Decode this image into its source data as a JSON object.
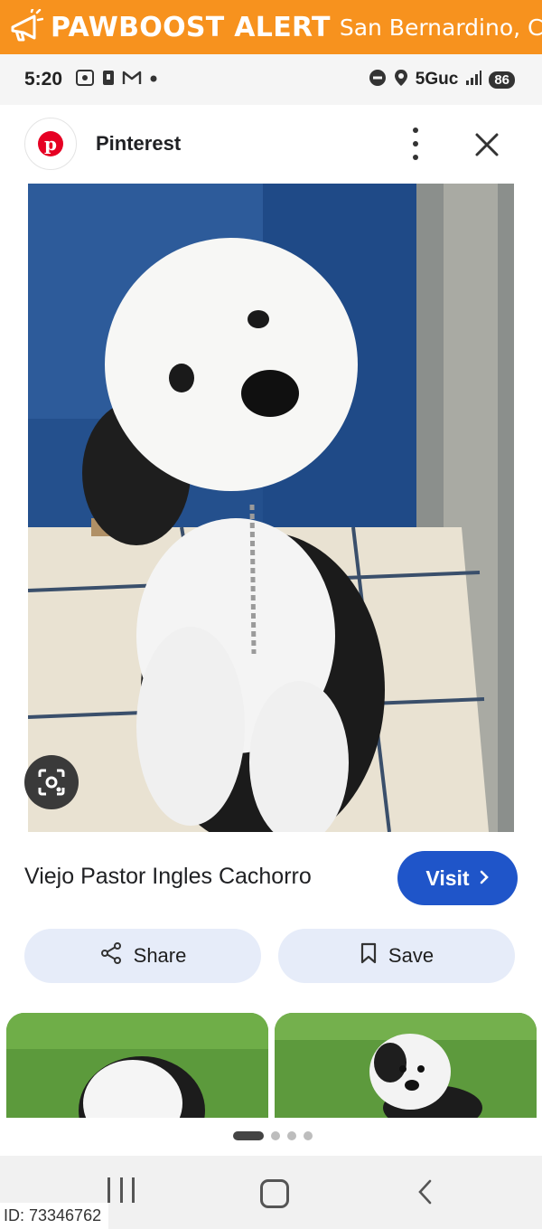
{
  "alert_banner": {
    "title": "PAWBOOST ALERT",
    "location": "San Bernardino, CA",
    "color": "#f7921e",
    "icon": "megaphone-icon"
  },
  "status_bar": {
    "time": "5:20",
    "network": "5Guc",
    "battery": "86",
    "left_icons": [
      "screenshot-icon",
      "lock-icon",
      "gmail-icon",
      "dot-icon"
    ],
    "right_icons": [
      "do-not-disturb-icon",
      "location-icon",
      "signal-icon"
    ]
  },
  "header": {
    "site_name": "Pinterest",
    "logo_letter": "p",
    "brand_color": "#e60023"
  },
  "result": {
    "title": "Viejo Pastor Ingles Cachorro",
    "visit_label": "Visit",
    "share_label": "Share",
    "save_label": "Save",
    "accent": "#1f55c9"
  },
  "carousel": {
    "page_count": 4,
    "active_page": 1
  },
  "footer": {
    "id_text": "ID: 73346762"
  }
}
